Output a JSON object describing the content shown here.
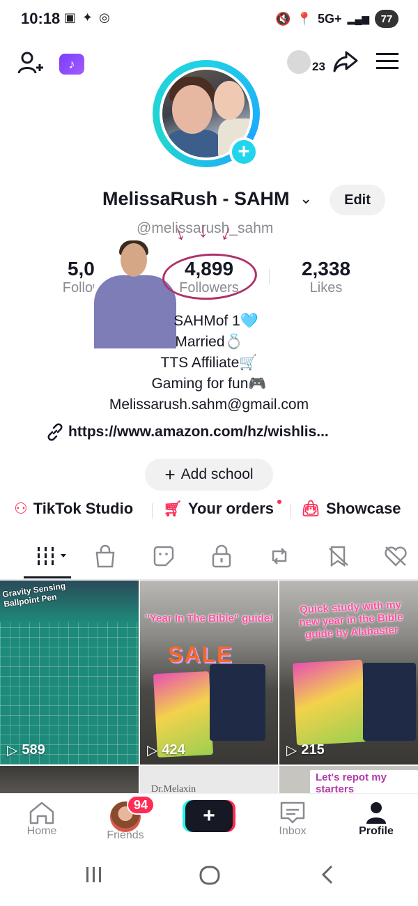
{
  "status_bar": {
    "time": "10:18",
    "left_icons": "▣ ✦ ◎",
    "network": "5G+",
    "battery": "77"
  },
  "header": {
    "add_friend_icon": "person-plus-icon",
    "tiktok_badge_icon": "tiktok-note-icon",
    "profile_views": "23",
    "share_icon": "share-arrow-icon",
    "menu_icon": "hamburger-icon"
  },
  "profile": {
    "display_name": "MelissaRush - SAHM",
    "chevron": "⌄",
    "edit_label": "Edit",
    "handle": "@melissarush_sahm",
    "avatar_plus": "+"
  },
  "stats": [
    {
      "value": "5,068",
      "label": "Following"
    },
    {
      "value": "4,899",
      "label": "Followers"
    },
    {
      "value": "2,338",
      "label": "Likes"
    }
  ],
  "bio": [
    "SAHMof 1🩵",
    "Married💍",
    "TTS Affiliate🛒",
    "Gaming for fun🎮",
    "Melissarush.sahm@gmail.com"
  ],
  "link": "https://www.amazon.com/hz/wishlis...",
  "add_school": "Add school",
  "tools": [
    {
      "label": "TikTok Studio",
      "icon": "person-star-icon"
    },
    {
      "label": "Your orders",
      "icon": "cart-icon"
    },
    {
      "label": "Showcase",
      "icon": "bag-icon"
    }
  ],
  "tabs": [
    {
      "name": "videos-tab",
      "icon": "grid-icon"
    },
    {
      "name": "shop-tab",
      "icon": "bag-icon"
    },
    {
      "name": "stickers-tab",
      "icon": "sticker-icon"
    },
    {
      "name": "private-tab",
      "icon": "lock-icon"
    },
    {
      "name": "reposts-tab",
      "icon": "repost-icon"
    },
    {
      "name": "saved-tab",
      "icon": "bookmark-hidden-icon"
    },
    {
      "name": "liked-tab",
      "icon": "heart-hidden-icon"
    }
  ],
  "videos": [
    {
      "caption": "Gravity Sensing Ballpoint Pen",
      "views": "589"
    },
    {
      "caption": "\"Year In The Bible\" guide!",
      "sale": "SALE",
      "views": "424"
    },
    {
      "caption": "Quick study with my new year in the Bible guide by Alabaster",
      "views": "215"
    },
    {
      "caption": ""
    },
    {
      "caption": "Dr.Melaxin"
    },
    {
      "caption": "Let's repot my starters"
    }
  ],
  "bottom_nav": {
    "home": "Home",
    "friends": "Friends",
    "friends_badge": "94",
    "create": "+",
    "inbox": "Inbox",
    "profile": "Profile"
  },
  "colors": {
    "accent": "#fe2c55",
    "teal": "#20d5ec",
    "annotation": "#b0306a"
  }
}
